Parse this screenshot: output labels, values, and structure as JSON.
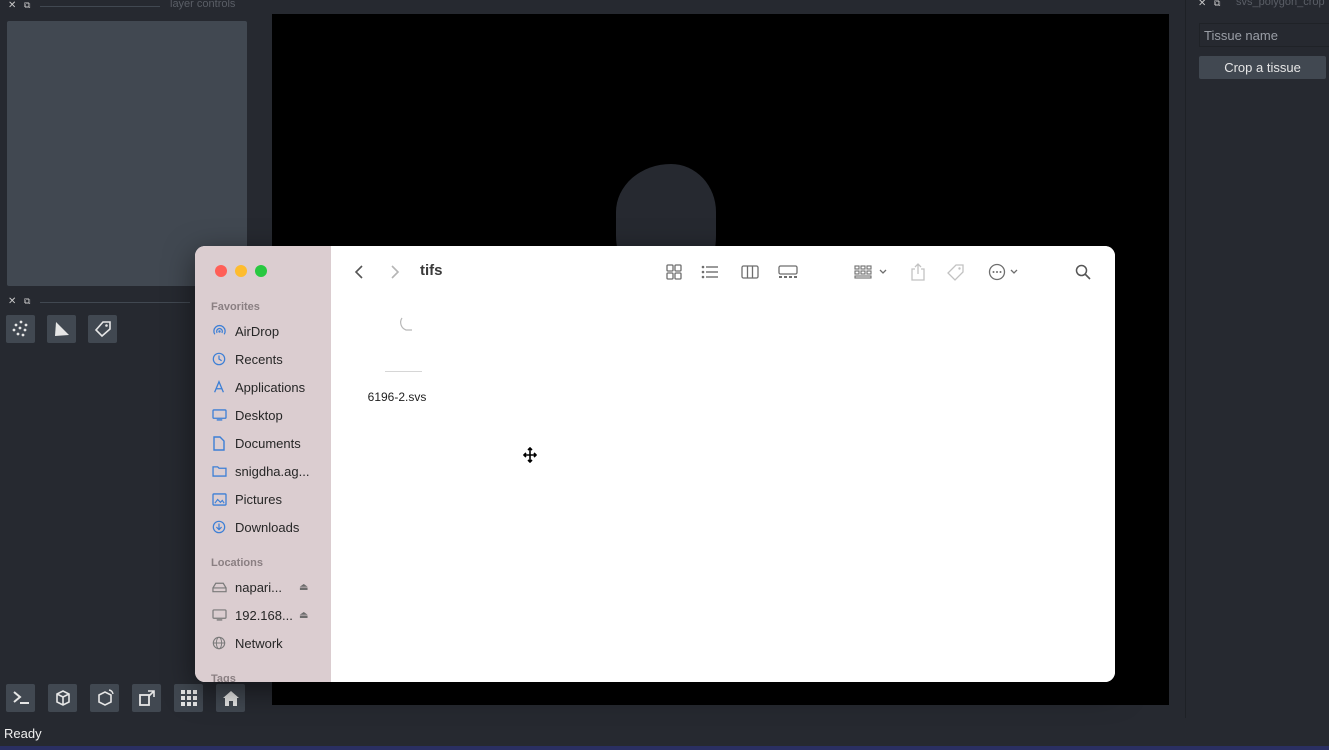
{
  "napari": {
    "left_dock_title": "layer controls",
    "right_dock_title": "svs_polygon_crop",
    "tissue_placeholder": "Tissue name",
    "crop_button": "Crop a tissue",
    "status": "Ready",
    "layer_tools": [
      "points-icon",
      "shapes-icon",
      "labels-icon"
    ],
    "bottom_tools": [
      "console-icon",
      "ndisplay-icon",
      "roll-icon",
      "transpose-icon",
      "grid-icon",
      "home-icon"
    ]
  },
  "finder": {
    "folder": "tifs",
    "favorites_label": "Favorites",
    "locations_label": "Locations",
    "tags_label": "Tags",
    "favorites": [
      {
        "label": "AirDrop",
        "icon": "airdrop-icon"
      },
      {
        "label": "Recents",
        "icon": "clock-icon"
      },
      {
        "label": "Applications",
        "icon": "applications-icon"
      },
      {
        "label": "Desktop",
        "icon": "desktop-icon"
      },
      {
        "label": "Documents",
        "icon": "document-icon"
      },
      {
        "label": "snigdha.ag...",
        "icon": "folder-icon"
      },
      {
        "label": "Pictures",
        "icon": "pictures-icon"
      },
      {
        "label": "Downloads",
        "icon": "downloads-icon"
      }
    ],
    "locations": [
      {
        "label": "napari...",
        "icon": "drive-icon",
        "eject": true
      },
      {
        "label": "192.168...",
        "icon": "display-icon",
        "eject": true
      },
      {
        "label": "Network",
        "icon": "globe-icon",
        "eject": false
      }
    ],
    "files": [
      {
        "name": "6196-2.svs"
      }
    ]
  }
}
